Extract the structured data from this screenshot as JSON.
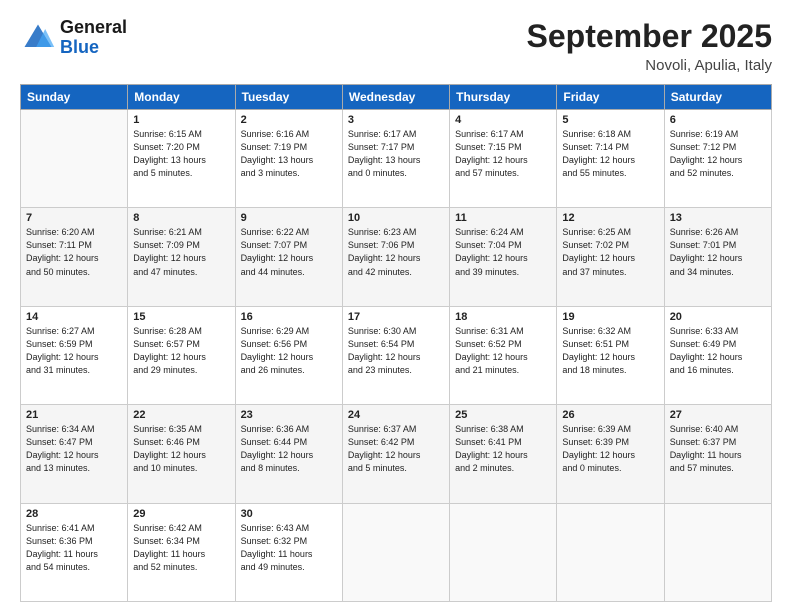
{
  "header": {
    "logo_general": "General",
    "logo_blue": "Blue",
    "month": "September 2025",
    "location": "Novoli, Apulia, Italy"
  },
  "days_of_week": [
    "Sunday",
    "Monday",
    "Tuesday",
    "Wednesday",
    "Thursday",
    "Friday",
    "Saturday"
  ],
  "weeks": [
    [
      {
        "day": "",
        "info": ""
      },
      {
        "day": "1",
        "info": "Sunrise: 6:15 AM\nSunset: 7:20 PM\nDaylight: 13 hours\nand 5 minutes."
      },
      {
        "day": "2",
        "info": "Sunrise: 6:16 AM\nSunset: 7:19 PM\nDaylight: 13 hours\nand 3 minutes."
      },
      {
        "day": "3",
        "info": "Sunrise: 6:17 AM\nSunset: 7:17 PM\nDaylight: 13 hours\nand 0 minutes."
      },
      {
        "day": "4",
        "info": "Sunrise: 6:17 AM\nSunset: 7:15 PM\nDaylight: 12 hours\nand 57 minutes."
      },
      {
        "day": "5",
        "info": "Sunrise: 6:18 AM\nSunset: 7:14 PM\nDaylight: 12 hours\nand 55 minutes."
      },
      {
        "day": "6",
        "info": "Sunrise: 6:19 AM\nSunset: 7:12 PM\nDaylight: 12 hours\nand 52 minutes."
      }
    ],
    [
      {
        "day": "7",
        "info": "Sunrise: 6:20 AM\nSunset: 7:11 PM\nDaylight: 12 hours\nand 50 minutes."
      },
      {
        "day": "8",
        "info": "Sunrise: 6:21 AM\nSunset: 7:09 PM\nDaylight: 12 hours\nand 47 minutes."
      },
      {
        "day": "9",
        "info": "Sunrise: 6:22 AM\nSunset: 7:07 PM\nDaylight: 12 hours\nand 44 minutes."
      },
      {
        "day": "10",
        "info": "Sunrise: 6:23 AM\nSunset: 7:06 PM\nDaylight: 12 hours\nand 42 minutes."
      },
      {
        "day": "11",
        "info": "Sunrise: 6:24 AM\nSunset: 7:04 PM\nDaylight: 12 hours\nand 39 minutes."
      },
      {
        "day": "12",
        "info": "Sunrise: 6:25 AM\nSunset: 7:02 PM\nDaylight: 12 hours\nand 37 minutes."
      },
      {
        "day": "13",
        "info": "Sunrise: 6:26 AM\nSunset: 7:01 PM\nDaylight: 12 hours\nand 34 minutes."
      }
    ],
    [
      {
        "day": "14",
        "info": "Sunrise: 6:27 AM\nSunset: 6:59 PM\nDaylight: 12 hours\nand 31 minutes."
      },
      {
        "day": "15",
        "info": "Sunrise: 6:28 AM\nSunset: 6:57 PM\nDaylight: 12 hours\nand 29 minutes."
      },
      {
        "day": "16",
        "info": "Sunrise: 6:29 AM\nSunset: 6:56 PM\nDaylight: 12 hours\nand 26 minutes."
      },
      {
        "day": "17",
        "info": "Sunrise: 6:30 AM\nSunset: 6:54 PM\nDaylight: 12 hours\nand 23 minutes."
      },
      {
        "day": "18",
        "info": "Sunrise: 6:31 AM\nSunset: 6:52 PM\nDaylight: 12 hours\nand 21 minutes."
      },
      {
        "day": "19",
        "info": "Sunrise: 6:32 AM\nSunset: 6:51 PM\nDaylight: 12 hours\nand 18 minutes."
      },
      {
        "day": "20",
        "info": "Sunrise: 6:33 AM\nSunset: 6:49 PM\nDaylight: 12 hours\nand 16 minutes."
      }
    ],
    [
      {
        "day": "21",
        "info": "Sunrise: 6:34 AM\nSunset: 6:47 PM\nDaylight: 12 hours\nand 13 minutes."
      },
      {
        "day": "22",
        "info": "Sunrise: 6:35 AM\nSunset: 6:46 PM\nDaylight: 12 hours\nand 10 minutes."
      },
      {
        "day": "23",
        "info": "Sunrise: 6:36 AM\nSunset: 6:44 PM\nDaylight: 12 hours\nand 8 minutes."
      },
      {
        "day": "24",
        "info": "Sunrise: 6:37 AM\nSunset: 6:42 PM\nDaylight: 12 hours\nand 5 minutes."
      },
      {
        "day": "25",
        "info": "Sunrise: 6:38 AM\nSunset: 6:41 PM\nDaylight: 12 hours\nand 2 minutes."
      },
      {
        "day": "26",
        "info": "Sunrise: 6:39 AM\nSunset: 6:39 PM\nDaylight: 12 hours\nand 0 minutes."
      },
      {
        "day": "27",
        "info": "Sunrise: 6:40 AM\nSunset: 6:37 PM\nDaylight: 11 hours\nand 57 minutes."
      }
    ],
    [
      {
        "day": "28",
        "info": "Sunrise: 6:41 AM\nSunset: 6:36 PM\nDaylight: 11 hours\nand 54 minutes."
      },
      {
        "day": "29",
        "info": "Sunrise: 6:42 AM\nSunset: 6:34 PM\nDaylight: 11 hours\nand 52 minutes."
      },
      {
        "day": "30",
        "info": "Sunrise: 6:43 AM\nSunset: 6:32 PM\nDaylight: 11 hours\nand 49 minutes."
      },
      {
        "day": "",
        "info": ""
      },
      {
        "day": "",
        "info": ""
      },
      {
        "day": "",
        "info": ""
      },
      {
        "day": "",
        "info": ""
      }
    ]
  ]
}
